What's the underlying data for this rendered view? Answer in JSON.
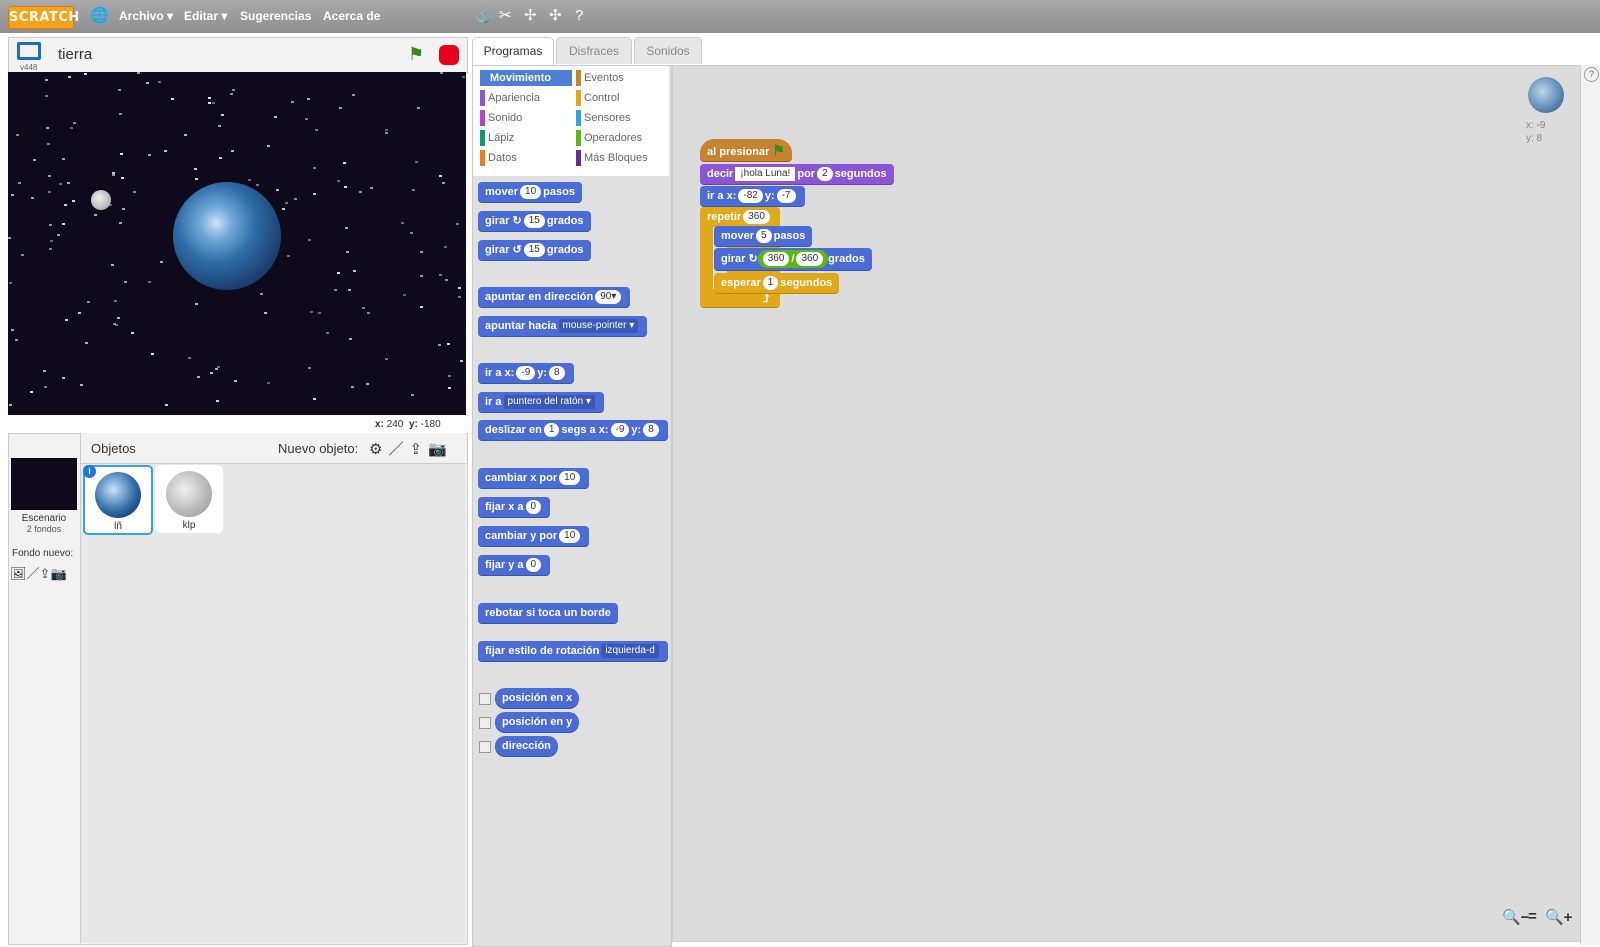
{
  "menu": {
    "logo": "SCRATCH",
    "items": [
      "Archivo ▾",
      "Editar ▾",
      "Sugerencias",
      "Acerca de"
    ]
  },
  "stage": {
    "title": "tierra",
    "version": "v448",
    "coords_x_label": "x:",
    "coords_x": "240",
    "coords_y_label": "y:",
    "coords_y": "-180"
  },
  "sprites": {
    "header": "Objetos",
    "new_sprite_label": "Nuevo objeto:",
    "stage_label": "Escenario",
    "stage_backdrops": "2 fondos",
    "new_backdrop_label": "Fondo nuevo:",
    "items": [
      {
        "name": "lñ"
      },
      {
        "name": "klp"
      }
    ]
  },
  "tabs": [
    "Programas",
    "Disfraces",
    "Sonidos"
  ],
  "categories": {
    "left": [
      "Movimiento",
      "Apariencia",
      "Sonido",
      "Lápiz",
      "Datos"
    ],
    "right": [
      "Eventos",
      "Control",
      "Sensores",
      "Operadores",
      "Más Bloques"
    ],
    "colors": {
      "Movimiento": "#4c80d6",
      "Apariencia": "#8a55d7",
      "Sonido": "#bb42c3",
      "Lápiz": "#0e9a6c",
      "Datos": "#ee7d16",
      "Eventos": "#c88330",
      "Control": "#e1a91a",
      "Sensores": "#2ca5e2",
      "Operadores": "#5cb712",
      "Más Bloques": "#632d99"
    }
  },
  "palette": {
    "move": {
      "a": "mover",
      "n": "10",
      "b": "pasos"
    },
    "turn_right": {
      "a": "girar ↻",
      "n": "15",
      "b": "grados"
    },
    "turn_left": {
      "a": "girar ↺",
      "n": "15",
      "b": "grados"
    },
    "point_dir": {
      "a": "apuntar en dirección",
      "d": "90▾"
    },
    "point_to": {
      "a": "apuntar hacia",
      "d": "mouse-pointer ▾"
    },
    "goto_xy": {
      "a": "ir a x:",
      "x": "-9",
      "b": "y:",
      "y": "8"
    },
    "goto": {
      "a": "ir a",
      "d": "puntero del ratón ▾"
    },
    "glide": {
      "a": "deslizar en",
      "n": "1",
      "b": "segs a x:",
      "x": "-9",
      "c": "y:",
      "y": "8"
    },
    "change_x": {
      "a": "cambiar x por",
      "n": "10"
    },
    "set_x": {
      "a": "fijar x a",
      "n": "0"
    },
    "change_y": {
      "a": "cambiar y por",
      "n": "10"
    },
    "set_y": {
      "a": "fijar y a",
      "n": "0"
    },
    "bounce": "rebotar si toca un borde",
    "rotation_style": {
      "a": "fijar estilo de rotación",
      "d": "izquierda-d"
    },
    "reporters": [
      "posición en x",
      "posición en y",
      "dirección"
    ]
  },
  "script": {
    "hat": "al presionar",
    "say": {
      "a": "decir",
      "s": "¡hola Luna!",
      "b": "por",
      "n": "2",
      "c": "segundos"
    },
    "goto": {
      "a": "ir a x:",
      "x": "-82",
      "b": "y:",
      "y": "-7"
    },
    "repeat": {
      "a": "repetir",
      "n": "360"
    },
    "move": {
      "a": "mover",
      "n": "5",
      "b": "pasos"
    },
    "turn": {
      "a": "girar ↻",
      "l": "360",
      "op": "/",
      "r": "360",
      "b": "grados"
    },
    "wait": {
      "a": "esperar",
      "n": "1",
      "b": "segundos"
    },
    "sprite_x": "x: -9",
    "sprite_y": "y: 8"
  }
}
